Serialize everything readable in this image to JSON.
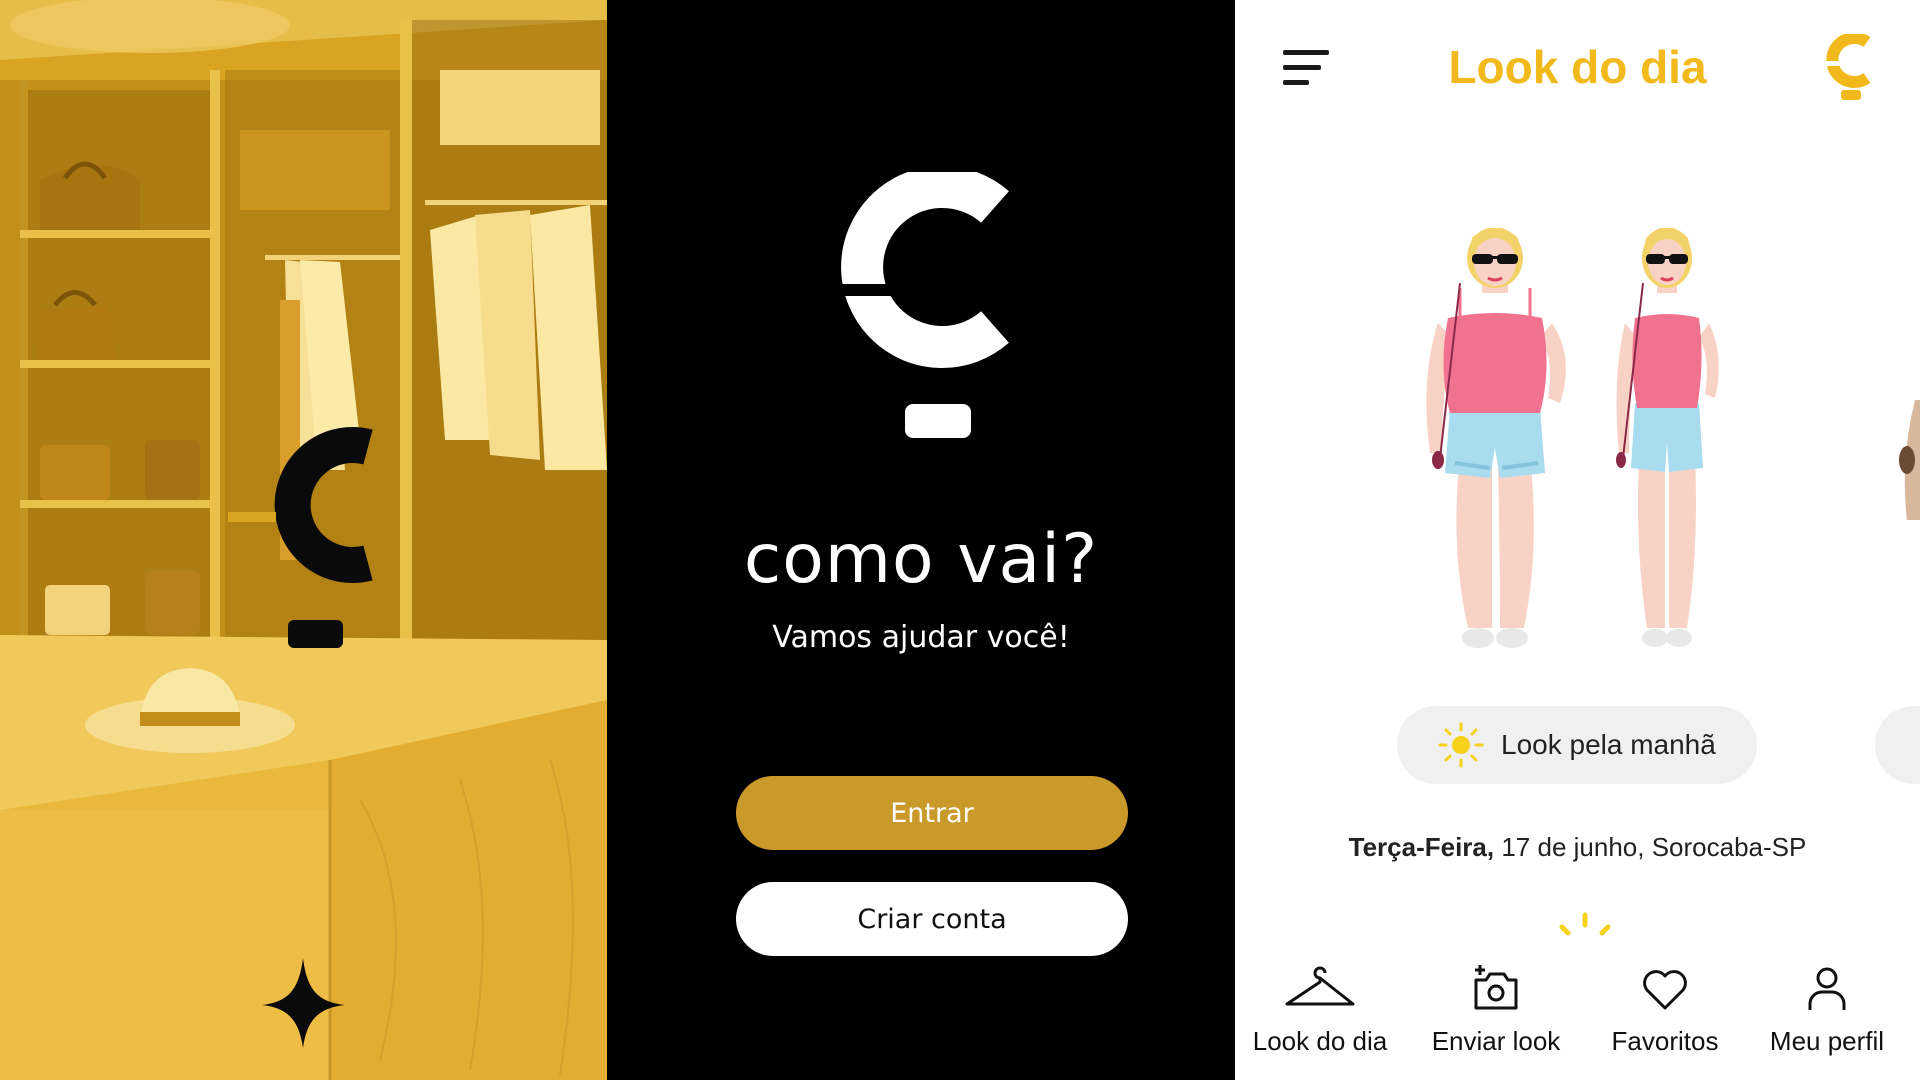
{
  "colors": {
    "brand_yellow": "#f2b91c",
    "closet_yellow": "#d9a520",
    "gold_button": "#c9992a",
    "black": "#000000",
    "white": "#ffffff",
    "pill_gray": "#f0f0f0"
  },
  "welcome": {
    "title": "como vai?",
    "subtitle": "Vamos ajudar você!",
    "login_label": "Entrar",
    "signup_label": "Criar conta"
  },
  "app": {
    "title": "Look do dia",
    "period_label": "Look pela manhã",
    "date": {
      "weekday": "Terça-Feira,",
      "day": "17 de junho,",
      "city": "Sorocaba-SP"
    },
    "tabs": [
      {
        "label": "Look do dia",
        "icon": "hanger-icon"
      },
      {
        "label": "Enviar look",
        "icon": "add-photo-icon"
      },
      {
        "label": "Favoritos",
        "icon": "heart-icon"
      },
      {
        "label": "Meu perfil",
        "icon": "user-icon"
      }
    ]
  }
}
